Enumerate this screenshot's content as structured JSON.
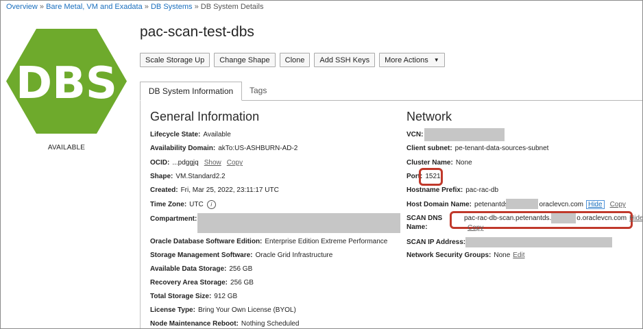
{
  "breadcrumb": {
    "items": [
      "Overview",
      "Bare Metal, VM and Exadata",
      "DB Systems"
    ],
    "separator": "»",
    "current": "DB System Details"
  },
  "logo": {
    "text": "DBS",
    "color": "#6eaa2c"
  },
  "status": "AVAILABLE",
  "title": "pac-scan-test-dbs",
  "toolbar": {
    "scale_storage": "Scale Storage Up",
    "change_shape": "Change Shape",
    "clone": "Clone",
    "add_ssh": "Add SSH Keys",
    "more_actions": "More Actions"
  },
  "tabs": {
    "info": "DB System Information",
    "tags": "Tags"
  },
  "general": {
    "title": "General Information",
    "lifecycle": {
      "label": "Lifecycle State:",
      "value": "Available"
    },
    "ad": {
      "label": "Availability Domain:",
      "value": "akTo:US-ASHBURN-AD-2"
    },
    "ocid": {
      "label": "OCID:",
      "value": "...pdggjq",
      "show": "Show",
      "copy": "Copy"
    },
    "shape": {
      "label": "Shape:",
      "value": "VM.Standard2.2"
    },
    "created": {
      "label": "Created:",
      "value": "Fri, Mar 25, 2022, 23:11:17 UTC"
    },
    "timezone": {
      "label": "Time Zone:",
      "value": "UTC"
    },
    "compartment": {
      "label": "Compartment:"
    },
    "edition": {
      "label": "Oracle Database Software Edition:",
      "value": "Enterprise Edition Extreme Performance"
    },
    "storage_mgmt": {
      "label": "Storage Management Software:",
      "value": "Oracle Grid Infrastructure"
    },
    "data_storage": {
      "label": "Available Data Storage:",
      "value": "256 GB"
    },
    "recovery": {
      "label": "Recovery Area Storage:",
      "value": "256 GB"
    },
    "total": {
      "label": "Total Storage Size:",
      "value": "912 GB"
    },
    "license": {
      "label": "License Type:",
      "value": "Bring Your Own License (BYOL)"
    },
    "reboot": {
      "label": "Node Maintenance Reboot:",
      "value": "Nothing Scheduled"
    }
  },
  "network": {
    "title": "Network",
    "vcn": {
      "label": "VCN:"
    },
    "subnet": {
      "label": "Client subnet:",
      "value": "pe-tenant-data-sources-subnet"
    },
    "cluster": {
      "label": "Cluster Name:",
      "value": "None"
    },
    "port": {
      "label": "Port:",
      "value": "1521"
    },
    "hostname": {
      "label": "Hostname Prefix:",
      "value": "pac-rac-db"
    },
    "domain": {
      "label": "Host Domain Name:",
      "value_start": "petenantds",
      "value_end": "oraclevcn.com",
      "hide": "Hide",
      "copy": "Copy"
    },
    "scan": {
      "label_line1": "SCAN DNS",
      "label_line2": "Name:",
      "value_start": "pac-rac-db-scan.petenantds.",
      "value_end": "o.oraclevcn.com",
      "hide": "Hide",
      "copy": "Copy"
    },
    "scan_ip": {
      "label": "SCAN IP Address:"
    },
    "nsg": {
      "label": "Network Security Groups:",
      "value": "None",
      "edit": "Edit"
    }
  }
}
